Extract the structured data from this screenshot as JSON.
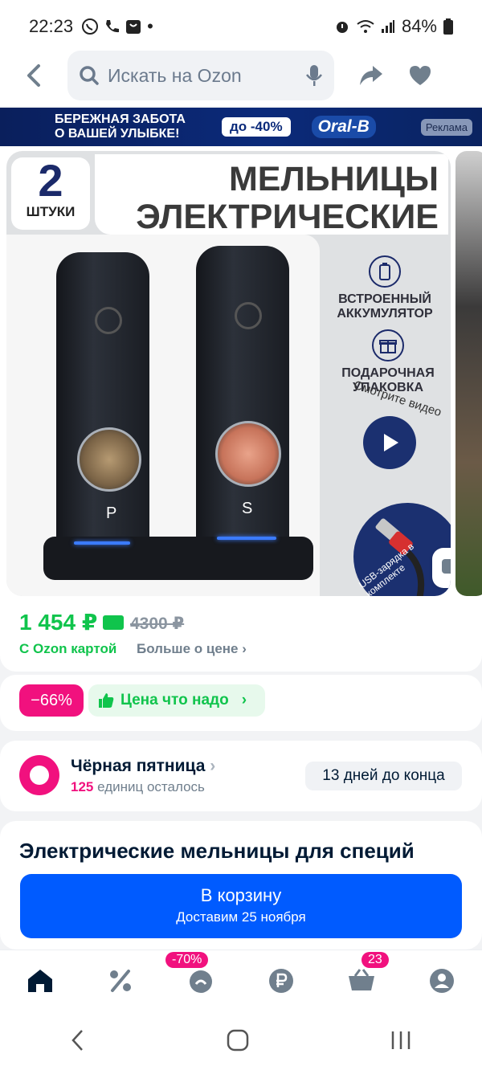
{
  "status_bar": {
    "time": "22:23",
    "battery": "84%"
  },
  "search": {
    "placeholder": "Искать на Ozon"
  },
  "ad_banner": {
    "text_line1": "БЕРЕЖНАЯ ЗАБОТА",
    "text_line2": "О ВАШЕЙ УЛЫБКЕ!",
    "discount": "до -40%",
    "brand": "Oral-B",
    "ad_label": "Реклама"
  },
  "product_image": {
    "count": "2",
    "count_unit": "ШТУКИ",
    "headline_line1": "МЕЛЬНИЦЫ",
    "headline_line2": "ЭЛЕКТРИЧЕСКИЕ",
    "feature1_line1": "ВСТРОЕННЫЙ",
    "feature1_line2": "АККУМУЛЯТОР",
    "feature2_line1": "ПОДАРОЧНАЯ",
    "feature2_line2": "УПАКОВКА",
    "video_label": "Смотрите видео",
    "usb_label": "USB-зарядка в комплекте",
    "grinder1_letter": "P",
    "grinder2_letter": "S"
  },
  "price": {
    "current": "1 454 ₽",
    "old": "4300 ₽",
    "card_label": "С Ozon картой",
    "more_label": "Больше о цене"
  },
  "badges": {
    "discount": "−66%",
    "good_price": "Цена что надо"
  },
  "black_friday": {
    "title": "Чёрная пятница",
    "units_left": "125",
    "units_left_suffix": "единиц осталось",
    "days_left": "13 дней до конца"
  },
  "product": {
    "title": "Электрические мельницы для специй"
  },
  "cart_button": {
    "label": "В корзину",
    "delivery": "Доставим 25 ноября"
  },
  "bottom_nav": {
    "sale_badge": "-70%",
    "cart_badge": "23"
  },
  "colors": {
    "accent": "#005bff",
    "green": "#10c44c",
    "pink": "#f1117e"
  }
}
